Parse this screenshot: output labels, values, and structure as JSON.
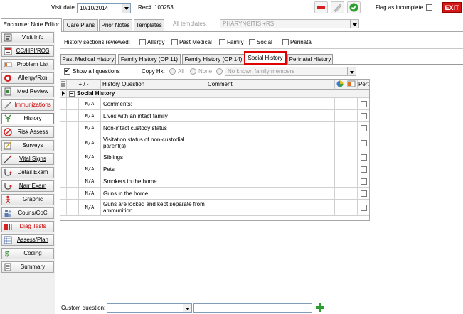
{
  "header": {
    "visit_date_label": "Visit date:",
    "visit_date_value": "10/10/2014",
    "rec_label": "Rec#",
    "rec_value": "100253",
    "flag_label": "Flag as incomplete",
    "exit_label": "EXIT"
  },
  "top_tabs": [
    {
      "label": "Encounter Note Editor"
    },
    {
      "label": "Care Plans"
    },
    {
      "label": "Prior Notes"
    },
    {
      "label": "Templates"
    }
  ],
  "templates": {
    "label": "All templates:",
    "value": "PHARYNGITIS +RS"
  },
  "sidebar": {
    "items": [
      {
        "label": "Visit Info",
        "icon": "visit-info-icon"
      },
      {
        "label": "CC/HPI/ROS",
        "icon": "cc-hpi-icon"
      },
      {
        "label": "Problem List",
        "icon": "problem-list-icon"
      },
      {
        "label": "Allergy/Rxn",
        "icon": "allergy-icon"
      },
      {
        "label": "Med Review",
        "icon": "med-review-icon"
      },
      {
        "label": "Immunizations",
        "icon": "immunizations-icon"
      },
      {
        "label": "History",
        "icon": "history-icon"
      },
      {
        "label": "Risk Assess",
        "icon": "risk-assess-icon"
      },
      {
        "label": "Surveys",
        "icon": "surveys-icon"
      },
      {
        "label": "Vital Signs",
        "icon": "vital-signs-icon"
      },
      {
        "label": "Detail Exam",
        "icon": "detail-exam-icon"
      },
      {
        "label": "Narr Exam",
        "icon": "narr-exam-icon"
      },
      {
        "label": "Graphic",
        "icon": "graphic-icon"
      },
      {
        "label": "Couns/CoC",
        "icon": "couns-icon"
      },
      {
        "label": "Diag Tests",
        "icon": "diag-tests-icon"
      },
      {
        "label": "Assess/Plan",
        "icon": "assess-plan-icon"
      },
      {
        "label": "Coding",
        "icon": "coding-icon"
      },
      {
        "label": "Summary",
        "icon": "summary-icon"
      }
    ]
  },
  "history_sections": {
    "label": "History sections reviewed:",
    "items": [
      "Allergy",
      "Past Medical",
      "Family",
      "Social",
      "Perinatal"
    ]
  },
  "sub_tabs": [
    {
      "label": "Past Medical History"
    },
    {
      "label": "Family History (OP 11)"
    },
    {
      "label": "Family History (OP 14)"
    },
    {
      "label": "Social History"
    },
    {
      "label": "Perinatal History"
    }
  ],
  "options": {
    "show_all": "Show all questions",
    "copy_hx": "Copy Hx:",
    "all": "All",
    "none": "None",
    "family_placeholder": "No known family members"
  },
  "grid": {
    "col_plusminus": "+ / -",
    "col_question": "History Question",
    "col_comment": "Comment",
    "col_pert": "Pert",
    "group": "Social History",
    "na_label": "N/A",
    "rows": [
      "Comments:",
      "Lives with an intact family",
      "Non-intact custody status",
      "Visitation status of non-custodial parent(s)",
      "Siblings",
      "Pets",
      "Smokers in the home",
      "Guns in the home",
      "Guns are locked and kept separate from ammunition"
    ]
  },
  "custom_question": {
    "label": "Custom question:"
  },
  "colors": {
    "active_highlight": "#e00000",
    "exit_bg": "#d41818",
    "add_green": "#2e9e2e"
  }
}
